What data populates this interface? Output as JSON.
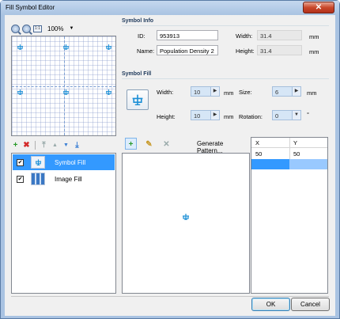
{
  "window": {
    "title": "Fill Symbol Editor",
    "close_glyph": "✕"
  },
  "preview": {
    "zoom": "100%",
    "zoom_dropdown_glyph": "▼",
    "fit_label": "1:1"
  },
  "symbol_info": {
    "group_label": "Symbol Info",
    "id_label": "ID:",
    "id_value": "953913",
    "name_label": "Name:",
    "name_value": "Population Density 2",
    "width_label": "Width:",
    "width_value": "31.4",
    "width_unit": "mm",
    "height_label": "Height:",
    "height_value": "31.4",
    "height_unit": "mm"
  },
  "symbol_fill": {
    "group_label": "Symbol Fill",
    "width_label": "Width:",
    "width_value": "10",
    "width_unit": "mm",
    "height_label": "Height:",
    "height_value": "10",
    "height_unit": "mm",
    "size_label": "Size:",
    "size_value": "6",
    "size_unit": "mm",
    "rotation_label": "Rotation:",
    "rotation_value": "0",
    "rotation_unit": "°",
    "spin_glyph": "▶",
    "dropdown_glyph": "▼"
  },
  "layer_toolbar": {
    "add": "+",
    "delete": "✖",
    "move_top": "⤒",
    "move_up": "▲",
    "move_down": "▼",
    "move_bottom": "⤓"
  },
  "layers": [
    {
      "label": "Symbol Fill",
      "checked": "✔",
      "selected": true
    },
    {
      "label": "Image Fill",
      "checked": "✔",
      "selected": false
    }
  ],
  "pattern_toolbar": {
    "add": "+",
    "edit": "✎",
    "delete": "✕",
    "generate_label": "Generate Pattern..."
  },
  "grid": {
    "columns": [
      "X",
      "Y"
    ],
    "rows": [
      [
        "50",
        "50"
      ]
    ]
  },
  "buttons": {
    "ok": "OK",
    "cancel": "Cancel"
  },
  "colors": {
    "selection": "#3399ff",
    "symbol": "#1b8fd6",
    "title_bar": "#a9c3e2"
  }
}
